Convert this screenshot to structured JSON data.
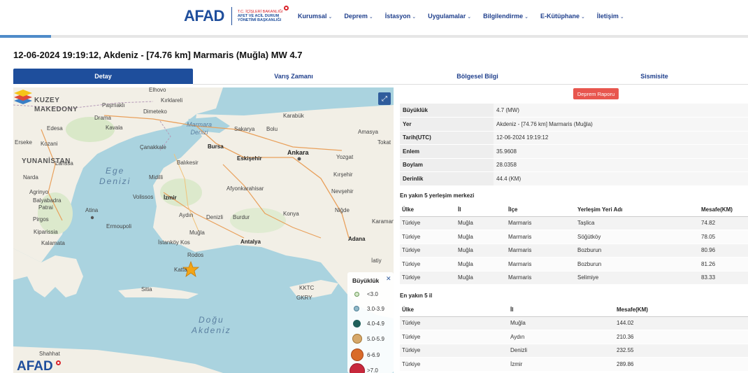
{
  "header": {
    "logo_text": "AFAD",
    "logo_sub_1": "T.C. İÇİŞLERİ BAKANLIĞI",
    "logo_sub_2": "AFET VE ACİL DURUM",
    "logo_sub_3": "YÖNETİMİ BAŞKANLIĞI",
    "nav": [
      "Kurumsal",
      "Deprem",
      "İstasyon",
      "Uygulamalar",
      "Bilgilendirme",
      "E-Kütüphane",
      "İletişim"
    ]
  },
  "title": "12-06-2024 19:19:12, Akdeniz - [74.76 km] Marmaris (Muğla) MW 4.7",
  "tabs": [
    "Detay",
    "Varış Zamanı",
    "Bölgesel Bilgi",
    "Sismisite"
  ],
  "active_tab": "Detay",
  "map": {
    "labels": {
      "kuzey_makedony": "KUZEY\nMAKEDONY",
      "yunanistan": "YUNANİSTAN",
      "ege_denizi": "Ege\nDenizi",
      "dogu_akdeniz": "Doğu\nAkdeniz",
      "marmara_denizi": "Marmara\nDenizi",
      "ankara": "Ankara",
      "bursa": "Bursa",
      "eskisehir": "Eskişehir",
      "izmir": "İzmir",
      "antalya": "Antalya",
      "adana": "Adana",
      "rodos": "Rodos",
      "atina": "Atina",
      "elhovo": "Elhovo",
      "kirklareli": "Kırklareli",
      "pasmakli": "Paşmaklı",
      "dimeteko": "Dimeteko",
      "drama": "Drama",
      "kavala": "Kavala",
      "edesa": "Edesa",
      "kozani": "Kozani",
      "erseke": "Erseke",
      "larissa": "Larissa",
      "narda": "Narda",
      "agrinyo": "Agrinyo",
      "balyabadra": "Balyabadra",
      "patrai": "Patrai",
      "pirgos": "Pirgos",
      "kiparissia": "Kiparissia",
      "kalamata": "Kalamata",
      "midilli": "Midilli",
      "volissos": "Volissos",
      "ermoupoli": "Ermoupoli",
      "canakkale": "Çanakkale",
      "balikesir": "Balıkesir",
      "aydin": "Aydın",
      "denizli": "Denizli",
      "burdur": "Burdur",
      "mugla": "Muğla",
      "istankoy": "İstanköy Kos",
      "katta": "Katta",
      "sitia": "Sitia",
      "afyon": "Afyonkarahisar",
      "konya": "Konya",
      "nevsehir": "Nevşehir",
      "nigde": "Niğde",
      "karaman": "Karaman",
      "kirsehir": "Kırşehir",
      "yozgat": "Yozgat",
      "karabuk": "Karabük",
      "sakarya": "Sakarya",
      "bolu": "Bolu",
      "amasya": "Amasya",
      "tokat": "Tokat",
      "kktc": "KKTC",
      "gkry": "GKRY",
      "shahhat": "Shahhat",
      "iatiy": "İatiy"
    },
    "legend": {
      "title": "Büyüklük",
      "items": [
        {
          "label": "<3.0",
          "color": "#d4e8c8",
          "border": "#6b9a5a"
        },
        {
          "label": "3.0-3.9",
          "color": "#8fb9c9",
          "border": "#4f7f95"
        },
        {
          "label": "4.0-4.9",
          "color": "#1f5f5a",
          "border": "#1f5f5a"
        },
        {
          "label": "5.0-5.9",
          "color": "#d6a86a",
          "border": "#a47635"
        },
        {
          "label": "6-6.9",
          "color": "#d96b2a",
          "border": "#a7461a"
        },
        {
          "label": ">7.0",
          "color": "#c8283c",
          "border": "#961a2b"
        }
      ]
    },
    "watermark": "AFAD"
  },
  "report_button": "Deprem Raporu",
  "info_rows": [
    {
      "key": "Büyüklük",
      "value": "4.7 (MW)"
    },
    {
      "key": "Yer",
      "value": "Akdeniz - [74.76 km] Marmaris (Muğla)"
    },
    {
      "key": "Tarih(UTC)",
      "value": "12-06-2024 19:19:12"
    },
    {
      "key": "Enlem",
      "value": "35.9608"
    },
    {
      "key": "Boylam",
      "value": "28.0358"
    },
    {
      "key": "Derinlik",
      "value": "44.4 (KM)"
    }
  ],
  "settlements": {
    "title": "En yakın 5 yerleşim merkezi",
    "headers": [
      "Ülke",
      "İl",
      "İlçe",
      "Yerleşim Yeri Adı",
      "Mesafe(KM)"
    ],
    "rows": [
      [
        "Türkiye",
        "Muğla",
        "Marmaris",
        "Taşlica",
        "74.82"
      ],
      [
        "Türkiye",
        "Muğla",
        "Marmaris",
        "Söğütköy",
        "78.05"
      ],
      [
        "Türkiye",
        "Muğla",
        "Marmaris",
        "Bozburun",
        "80.96"
      ],
      [
        "Türkiye",
        "Muğla",
        "Marmaris",
        "Bozburun",
        "81.26"
      ],
      [
        "Türkiye",
        "Muğla",
        "Marmaris",
        "Selimiye",
        "83.33"
      ]
    ]
  },
  "provinces": {
    "title": "En yakın 5 il",
    "headers": [
      "Ülke",
      "İl",
      "Mesafe(KM)"
    ],
    "rows": [
      [
        "Türkiye",
        "Muğla",
        "144.02"
      ],
      [
        "Türkiye",
        "Aydın",
        "210.36"
      ],
      [
        "Türkiye",
        "Denizli",
        "232.55"
      ],
      [
        "Türkiye",
        "İzmir",
        "289.86"
      ]
    ]
  }
}
